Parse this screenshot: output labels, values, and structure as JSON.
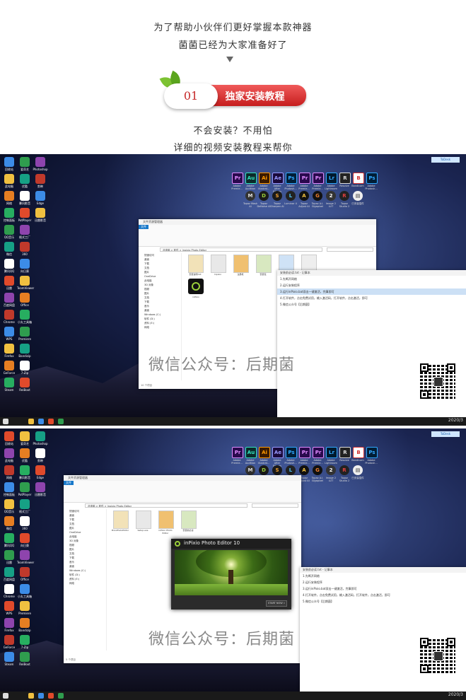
{
  "intro": {
    "line1": "为了帮助小伙伴们更好掌握本款神器",
    "line2": "菌菌已经为大家准备好了",
    "arrow": "▼",
    "badge_number": "01",
    "badge_title": "独家安装教程",
    "line3": "不会安装？不用怕",
    "line4": "详细的视频安装教程来帮你"
  },
  "watermark": "微信公众号：后期菌",
  "shot1": {
    "explorer_address": "此电脑 > 软件 > Inpixio Photo Editor",
    "status": "10 个项目",
    "nav_items": [
      "快速访问",
      "桌面",
      "下载",
      "文档",
      "图片",
      "OneDrive",
      "此电脑",
      "3D 对象",
      "视频",
      "图片",
      "文档",
      "下载",
      "音乐",
      "桌面",
      "Windows (C:)",
      "软件 (D:)",
      "资料 (E:)",
      "网络"
    ],
    "files": [
      "安装说明.txt",
      "Inpixio",
      "注册机",
      "安装包",
      "inPixio Photo Editor",
      "Setup"
    ],
    "app_label": "inPixio",
    "notepad_lines": [
      "1.先断开网络",
      "2.运行安装程序",
      "3.运行inPixio.bat双击一键激活，完事即可",
      "4.打开软件，点击免费试用，输入激活码，打开软件，点击激活，即可",
      "5.微信公众号【后期菌】"
    ],
    "notepad_highlight_index": 2
  },
  "shot2": {
    "explorer_address": "此电脑 > 软件 > Inpixio Photo Editor",
    "status": "5 个项目",
    "nav_items": [
      "快速访问",
      "桌面",
      "下载",
      "文档",
      "图片",
      "OneDrive",
      "此电脑",
      "3D 对象",
      "视频",
      "图片",
      "文档",
      "下载",
      "音乐",
      "桌面",
      "Windows (C:)",
      "软件 (D:)",
      "资料 (E:)",
      "网络"
    ],
    "files": [
      "PixioPhotoEditor",
      "Setup.exe",
      "inPixio Photo Editor",
      "安装前必读"
    ],
    "dialog_title": "inPixio Photo Editor 10",
    "dialog_button": "START NOW »",
    "notepad_lines": [
      "1.先断开网络",
      "2.运行安装程序",
      "3.运行inPixio.bat双击一键激活，完事即可",
      "4.打开软件，点击免费试用，输入激活码，打开软件，点击激活，即可",
      "5.微信公众号【后期菌】"
    ]
  },
  "adobe_apps": [
    {
      "abbr": "Pr",
      "name": "Adobe Premie...",
      "color": "#2a0a4e",
      "fg": "#e08bff"
    },
    {
      "abbr": "Au",
      "name": "Adobe Audition",
      "color": "#0b2a2a",
      "fg": "#32e3c0"
    },
    {
      "abbr": "Ai",
      "name": "Adobe Illustrat...",
      "color": "#3a1a00",
      "fg": "#ff9a00"
    },
    {
      "abbr": "Ae",
      "name": "Adobe After Effects",
      "color": "#1a0a3a",
      "fg": "#9999ff"
    },
    {
      "abbr": "Ps",
      "name": "Adobe Photosh...",
      "color": "#001e36",
      "fg": "#31a8ff"
    },
    {
      "abbr": "Pr",
      "name": "Adobe Premie...",
      "color": "#2a0a4e",
      "fg": "#e08bff"
    },
    {
      "abbr": "Pr",
      "name": "Adobe Premie...",
      "color": "#2a0a4e",
      "fg": "#e08bff"
    },
    {
      "abbr": "Lr",
      "name": "Adobe Lightroom",
      "color": "#001a2e",
      "fg": "#31a8ff"
    },
    {
      "abbr": "R",
      "name": "Resolve",
      "color": "#222",
      "fg": "#ddd"
    },
    {
      "abbr": "B",
      "name": "Bandicam",
      "color": "#ffffff",
      "fg": "#d03030"
    },
    {
      "abbr": "Ps",
      "name": "Adobe Photosh...",
      "color": "#001e36",
      "fg": "#31a8ff"
    }
  ],
  "adobe_row2": [
    {
      "abbr": "M",
      "name": "Topaz Mask AI",
      "color": "#333",
      "fg": "#ddd"
    },
    {
      "abbr": "D",
      "name": "Topaz DeNoise AI",
      "color": "#1a1a1a",
      "fg": "#9bcf3a"
    },
    {
      "abbr": "S",
      "name": "Topaz Sharpen AI",
      "color": "#1a1a1a",
      "fg": "#f0a030"
    },
    {
      "abbr": "L",
      "name": "Luminar 4",
      "color": "#222",
      "fg": "#4fc3f7"
    },
    {
      "abbr": "A",
      "name": "Topaz Adjust AI",
      "color": "#111",
      "fg": "#f0c040"
    },
    {
      "abbr": "G",
      "name": "Topaz A.I. Gigapixel",
      "color": "#111",
      "fg": "#f08030"
    },
    {
      "abbr": "2",
      "name": "Image 2 LUT",
      "color": "#333",
      "fg": "#fff"
    },
    {
      "abbr": "R",
      "name": "Topaz Studio 2",
      "color": "#222",
      "fg": "#e04040"
    },
    {
      "abbr": "▤",
      "name": "已安装插件",
      "color": "#eee",
      "fg": "#333"
    }
  ],
  "desktop_left": [
    "回收站",
    "此电脑",
    "网络",
    "控制面板",
    "QQ音乐",
    "微信",
    "腾讯QQ",
    "迅雷",
    "百度网盘",
    "Chrome",
    "WPS",
    "Firefox",
    "GeForce",
    "Steam",
    "爱奇艺",
    "优酷",
    "暴风影音",
    "PotPlayer",
    "格式工厂",
    "360",
    "向日葵",
    "TeamViewer",
    "Office",
    "小丸工具箱",
    "Premiere",
    "Bandizip",
    "7-Zip",
    "ReiBoot",
    "Photoshop",
    "剪映",
    "Edge",
    "迅雷影音"
  ],
  "taskbar_clock": "2020/3"
}
